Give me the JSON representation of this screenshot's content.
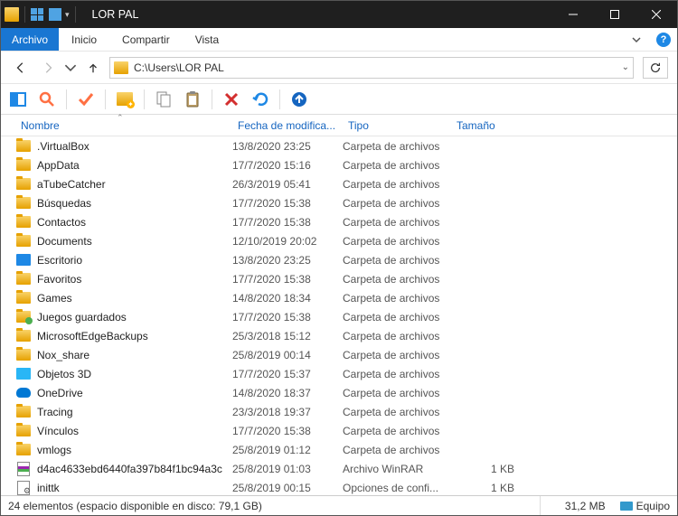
{
  "titlebar": {
    "title": "LOR PAL"
  },
  "menubar": {
    "file": "Archivo",
    "tabs": [
      "Inicio",
      "Compartir",
      "Vista"
    ]
  },
  "address": {
    "path": "C:\\Users\\LOR PAL"
  },
  "columns": {
    "name": "Nombre",
    "date": "Fecha de modifica...",
    "type": "Tipo",
    "size": "Tamaño"
  },
  "items": [
    {
      "icon": "folder",
      "name": ".VirtualBox",
      "date": "13/8/2020 23:25",
      "type": "Carpeta de archivos",
      "size": ""
    },
    {
      "icon": "folder",
      "name": "AppData",
      "date": "17/7/2020 15:16",
      "type": "Carpeta de archivos",
      "size": ""
    },
    {
      "icon": "folder",
      "name": "aTubeCatcher",
      "date": "26/3/2019 05:41",
      "type": "Carpeta de archivos",
      "size": ""
    },
    {
      "icon": "folder",
      "name": "Búsquedas",
      "date": "17/7/2020 15:38",
      "type": "Carpeta de archivos",
      "size": ""
    },
    {
      "icon": "folder",
      "name": "Contactos",
      "date": "17/7/2020 15:38",
      "type": "Carpeta de archivos",
      "size": ""
    },
    {
      "icon": "folder",
      "name": "Documents",
      "date": "12/10/2019 20:02",
      "type": "Carpeta de archivos",
      "size": ""
    },
    {
      "icon": "desktop",
      "name": "Escritorio",
      "date": "13/8/2020 23:25",
      "type": "Carpeta de archivos",
      "size": ""
    },
    {
      "icon": "folder",
      "name": "Favoritos",
      "date": "17/7/2020 15:38",
      "type": "Carpeta de archivos",
      "size": ""
    },
    {
      "icon": "folder",
      "name": "Games",
      "date": "14/8/2020 18:34",
      "type": "Carpeta de archivos",
      "size": ""
    },
    {
      "icon": "games",
      "name": "Juegos guardados",
      "date": "17/7/2020 15:38",
      "type": "Carpeta de archivos",
      "size": ""
    },
    {
      "icon": "folder",
      "name": "MicrosoftEdgeBackups",
      "date": "25/3/2018 15:12",
      "type": "Carpeta de archivos",
      "size": ""
    },
    {
      "icon": "folder",
      "name": "Nox_share",
      "date": "25/8/2019 00:14",
      "type": "Carpeta de archivos",
      "size": ""
    },
    {
      "icon": "3d",
      "name": "Objetos 3D",
      "date": "17/7/2020 15:37",
      "type": "Carpeta de archivos",
      "size": ""
    },
    {
      "icon": "onedrive",
      "name": "OneDrive",
      "date": "14/8/2020 18:37",
      "type": "Carpeta de archivos",
      "size": ""
    },
    {
      "icon": "folder",
      "name": "Tracing",
      "date": "23/3/2018 19:37",
      "type": "Carpeta de archivos",
      "size": ""
    },
    {
      "icon": "folder",
      "name": "Vínculos",
      "date": "17/7/2020 15:38",
      "type": "Carpeta de archivos",
      "size": ""
    },
    {
      "icon": "folder",
      "name": "vmlogs",
      "date": "25/8/2019 01:12",
      "type": "Carpeta de archivos",
      "size": ""
    },
    {
      "icon": "rar",
      "name": "d4ac4633ebd6440fa397b84f1bc94a3c",
      "date": "25/8/2019 01:03",
      "type": "Archivo WinRAR",
      "size": "1 KB"
    },
    {
      "icon": "cfg",
      "name": "inittk",
      "date": "25/8/2019 00:15",
      "type": "Opciones de confi...",
      "size": "1 KB"
    }
  ],
  "statusbar": {
    "summary": "24 elementos (espacio disponible en disco: 79,1 GB)",
    "size": "31,2 MB",
    "location": "Equipo"
  }
}
